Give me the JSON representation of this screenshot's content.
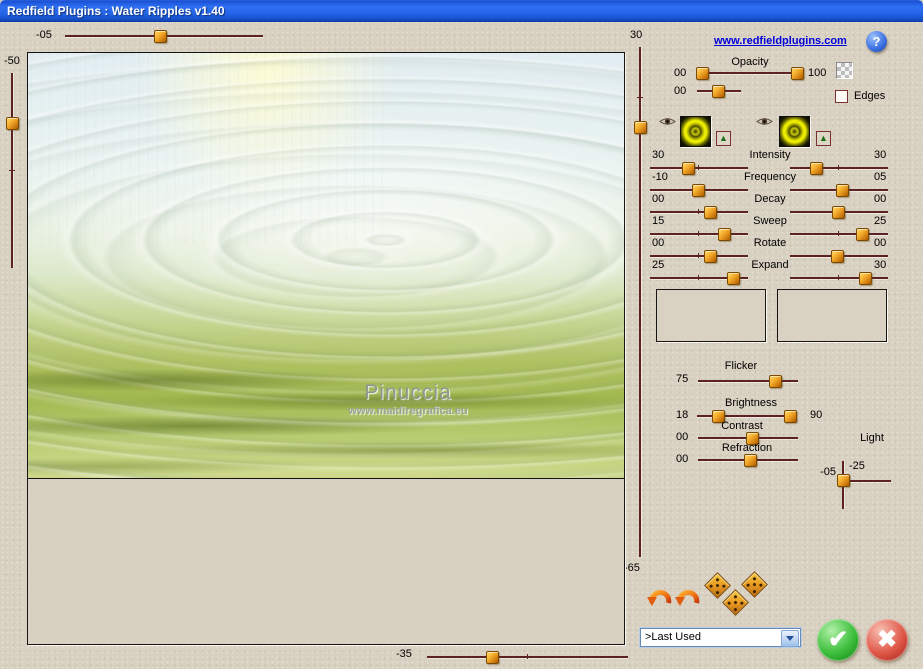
{
  "window": {
    "title": "Redfield Plugins : Water Ripples v1.40"
  },
  "header": {
    "link_text": "www.redfieldplugins.com",
    "help_glyph": "?"
  },
  "nav": {
    "top_value": "-05",
    "left_value": "-50",
    "right_top_value": "30",
    "right_bottom_value": "-65",
    "bottom_value": "-35"
  },
  "opacity": {
    "label": "Opacity",
    "min_value": "00",
    "max_value": "100",
    "row2_value": "00"
  },
  "edges": {
    "label": "Edges"
  },
  "channels": {
    "triangle_glyph": "▲"
  },
  "params": [
    {
      "label": "Intensity",
      "left": "30",
      "right": "30",
      "lpos": 688,
      "rpos": 816
    },
    {
      "label": "Frequency",
      "left": "-10",
      "right": "05",
      "lpos": 698,
      "rpos": 842
    },
    {
      "label": "Decay",
      "left": "00",
      "right": "00",
      "lpos": 710,
      "rpos": 838
    },
    {
      "label": "Sweep",
      "left": "15",
      "right": "25",
      "lpos": 724,
      "rpos": 862
    },
    {
      "label": "Rotate",
      "left": "00",
      "right": "00",
      "lpos": 710,
      "rpos": 837
    },
    {
      "label": "Expand",
      "left": "25",
      "right": "30",
      "lpos": 733,
      "rpos": 865
    }
  ],
  "adjust": {
    "flicker_label": "Flicker",
    "flicker_value": "75",
    "brightness_label": "Brightness",
    "brightness_left": "18",
    "brightness_right": "90",
    "contrast_label": "Contrast",
    "contrast_value": "00",
    "refraction_label": "Refraction",
    "refraction_value": "00"
  },
  "light": {
    "label": "Light",
    "h_value": "-05",
    "v_value": "-25"
  },
  "preview": {
    "watermark_title": "Pinuccia",
    "watermark_url": "www.maidiregrafica.eu"
  },
  "preset": {
    "value": ">Last Used"
  },
  "actions": {
    "ok_glyph": "✔",
    "cancel_glyph": "✖"
  },
  "colors": {
    "accent_orange": "#e08818",
    "track_maroon": "#5c2222",
    "link_blue": "#0000dd",
    "ok_green": "#28a428",
    "cancel_red": "#cc3a2a",
    "titlebar_blue": "#1c5ae0"
  }
}
